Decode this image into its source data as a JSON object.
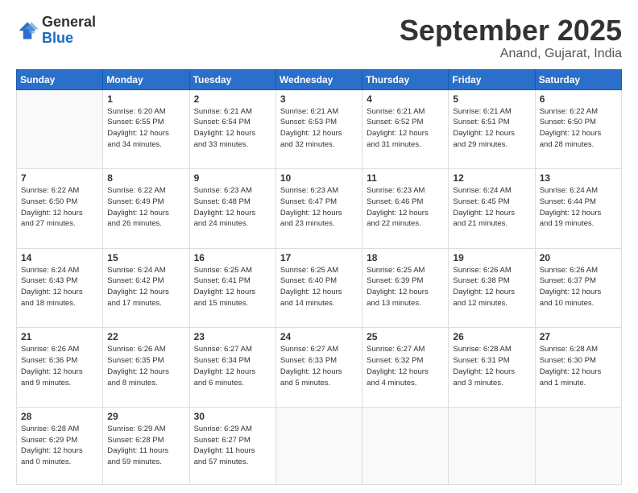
{
  "header": {
    "logo_general": "General",
    "logo_blue": "Blue",
    "month_title": "September 2025",
    "location": "Anand, Gujarat, India"
  },
  "weekdays": [
    "Sunday",
    "Monday",
    "Tuesday",
    "Wednesday",
    "Thursday",
    "Friday",
    "Saturday"
  ],
  "weeks": [
    [
      {
        "day": "",
        "info": ""
      },
      {
        "day": "1",
        "info": "Sunrise: 6:20 AM\nSunset: 6:55 PM\nDaylight: 12 hours\nand 34 minutes."
      },
      {
        "day": "2",
        "info": "Sunrise: 6:21 AM\nSunset: 6:54 PM\nDaylight: 12 hours\nand 33 minutes."
      },
      {
        "day": "3",
        "info": "Sunrise: 6:21 AM\nSunset: 6:53 PM\nDaylight: 12 hours\nand 32 minutes."
      },
      {
        "day": "4",
        "info": "Sunrise: 6:21 AM\nSunset: 6:52 PM\nDaylight: 12 hours\nand 31 minutes."
      },
      {
        "day": "5",
        "info": "Sunrise: 6:21 AM\nSunset: 6:51 PM\nDaylight: 12 hours\nand 29 minutes."
      },
      {
        "day": "6",
        "info": "Sunrise: 6:22 AM\nSunset: 6:50 PM\nDaylight: 12 hours\nand 28 minutes."
      }
    ],
    [
      {
        "day": "7",
        "info": "Sunrise: 6:22 AM\nSunset: 6:50 PM\nDaylight: 12 hours\nand 27 minutes."
      },
      {
        "day": "8",
        "info": "Sunrise: 6:22 AM\nSunset: 6:49 PM\nDaylight: 12 hours\nand 26 minutes."
      },
      {
        "day": "9",
        "info": "Sunrise: 6:23 AM\nSunset: 6:48 PM\nDaylight: 12 hours\nand 24 minutes."
      },
      {
        "day": "10",
        "info": "Sunrise: 6:23 AM\nSunset: 6:47 PM\nDaylight: 12 hours\nand 23 minutes."
      },
      {
        "day": "11",
        "info": "Sunrise: 6:23 AM\nSunset: 6:46 PM\nDaylight: 12 hours\nand 22 minutes."
      },
      {
        "day": "12",
        "info": "Sunrise: 6:24 AM\nSunset: 6:45 PM\nDaylight: 12 hours\nand 21 minutes."
      },
      {
        "day": "13",
        "info": "Sunrise: 6:24 AM\nSunset: 6:44 PM\nDaylight: 12 hours\nand 19 minutes."
      }
    ],
    [
      {
        "day": "14",
        "info": "Sunrise: 6:24 AM\nSunset: 6:43 PM\nDaylight: 12 hours\nand 18 minutes."
      },
      {
        "day": "15",
        "info": "Sunrise: 6:24 AM\nSunset: 6:42 PM\nDaylight: 12 hours\nand 17 minutes."
      },
      {
        "day": "16",
        "info": "Sunrise: 6:25 AM\nSunset: 6:41 PM\nDaylight: 12 hours\nand 15 minutes."
      },
      {
        "day": "17",
        "info": "Sunrise: 6:25 AM\nSunset: 6:40 PM\nDaylight: 12 hours\nand 14 minutes."
      },
      {
        "day": "18",
        "info": "Sunrise: 6:25 AM\nSunset: 6:39 PM\nDaylight: 12 hours\nand 13 minutes."
      },
      {
        "day": "19",
        "info": "Sunrise: 6:26 AM\nSunset: 6:38 PM\nDaylight: 12 hours\nand 12 minutes."
      },
      {
        "day": "20",
        "info": "Sunrise: 6:26 AM\nSunset: 6:37 PM\nDaylight: 12 hours\nand 10 minutes."
      }
    ],
    [
      {
        "day": "21",
        "info": "Sunrise: 6:26 AM\nSunset: 6:36 PM\nDaylight: 12 hours\nand 9 minutes."
      },
      {
        "day": "22",
        "info": "Sunrise: 6:26 AM\nSunset: 6:35 PM\nDaylight: 12 hours\nand 8 minutes."
      },
      {
        "day": "23",
        "info": "Sunrise: 6:27 AM\nSunset: 6:34 PM\nDaylight: 12 hours\nand 6 minutes."
      },
      {
        "day": "24",
        "info": "Sunrise: 6:27 AM\nSunset: 6:33 PM\nDaylight: 12 hours\nand 5 minutes."
      },
      {
        "day": "25",
        "info": "Sunrise: 6:27 AM\nSunset: 6:32 PM\nDaylight: 12 hours\nand 4 minutes."
      },
      {
        "day": "26",
        "info": "Sunrise: 6:28 AM\nSunset: 6:31 PM\nDaylight: 12 hours\nand 3 minutes."
      },
      {
        "day": "27",
        "info": "Sunrise: 6:28 AM\nSunset: 6:30 PM\nDaylight: 12 hours\nand 1 minute."
      }
    ],
    [
      {
        "day": "28",
        "info": "Sunrise: 6:28 AM\nSunset: 6:29 PM\nDaylight: 12 hours\nand 0 minutes."
      },
      {
        "day": "29",
        "info": "Sunrise: 6:29 AM\nSunset: 6:28 PM\nDaylight: 11 hours\nand 59 minutes."
      },
      {
        "day": "30",
        "info": "Sunrise: 6:29 AM\nSunset: 6:27 PM\nDaylight: 11 hours\nand 57 minutes."
      },
      {
        "day": "",
        "info": ""
      },
      {
        "day": "",
        "info": ""
      },
      {
        "day": "",
        "info": ""
      },
      {
        "day": "",
        "info": ""
      }
    ]
  ]
}
